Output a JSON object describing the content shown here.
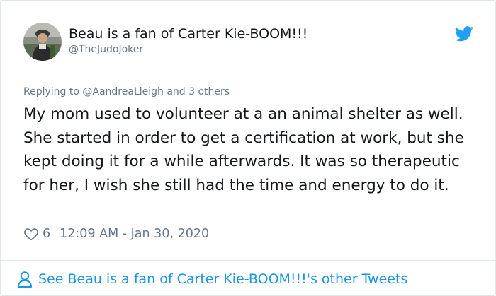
{
  "tweet": {
    "author": {
      "display_name": "Beau is a fan of Carter Kie-BOOM!!!",
      "handle": "@TheJudoJoker"
    },
    "reply_context": {
      "prefix": "Replying to ",
      "mention": "@AandreaLleigh",
      "suffix": " and 3 others"
    },
    "text": "My mom used to volunteer at a an animal shelter as well. She started in order to get a certification at work, but she kept doing it for a while afterwards. It was so therapeutic for her, I wish she still had the time and energy to do it.",
    "likes": "6",
    "timestamp": "12:09 AM - Jan 30, 2020",
    "footer_link": "See Beau is a fan of Carter Kie-BOOM!!!'s other Tweets"
  },
  "icons": {
    "brand": "twitter-bird-icon",
    "like": "heart-icon",
    "profile": "person-icon"
  },
  "colors": {
    "accent": "#1b95e0",
    "brand": "#1da1f2",
    "text": "#14171a",
    "muted": "#657786",
    "border": "#e1e8ed"
  }
}
